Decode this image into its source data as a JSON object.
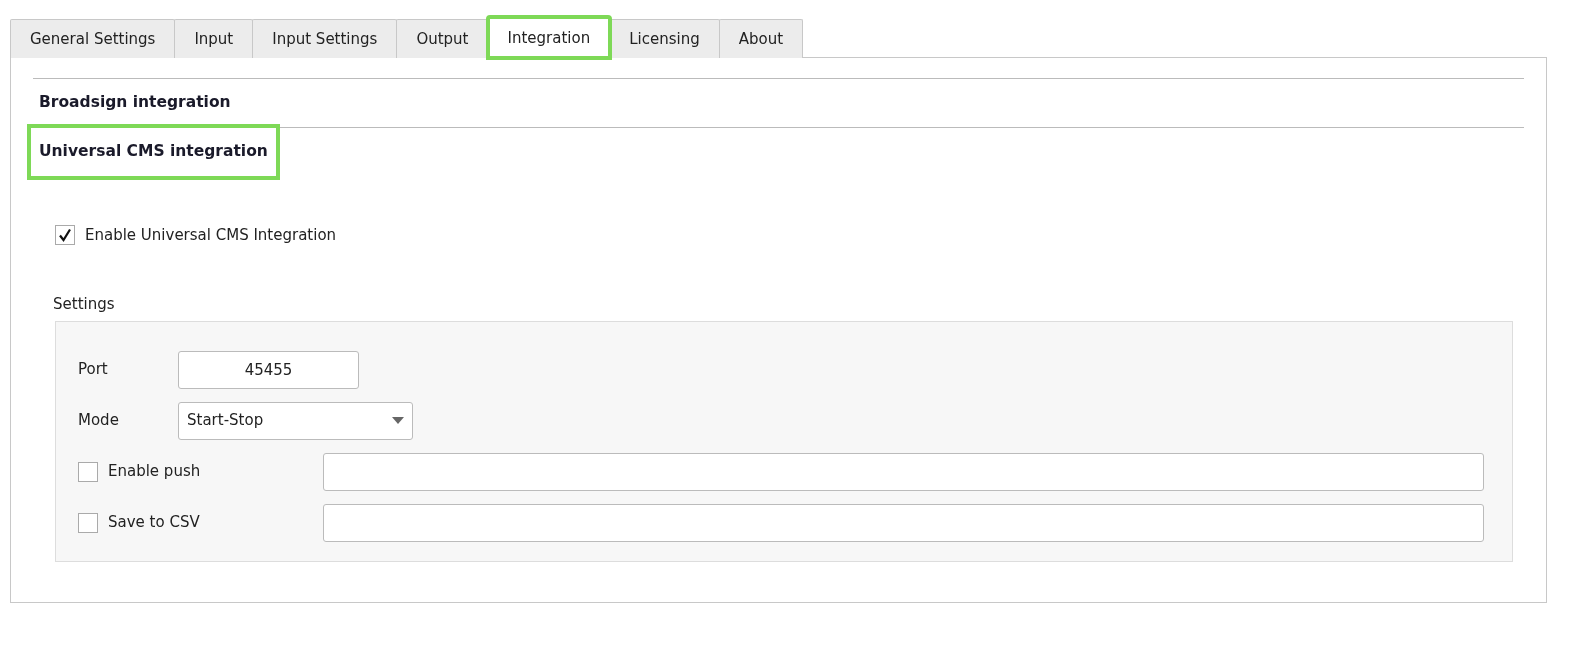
{
  "tabs": [
    {
      "label": "General Settings",
      "selected": false,
      "highlighted": false
    },
    {
      "label": "Input",
      "selected": false,
      "highlighted": false
    },
    {
      "label": "Input Settings",
      "selected": false,
      "highlighted": false
    },
    {
      "label": "Output",
      "selected": false,
      "highlighted": false
    },
    {
      "label": "Integration",
      "selected": true,
      "highlighted": true
    },
    {
      "label": "Licensing",
      "selected": false,
      "highlighted": false
    },
    {
      "label": "About",
      "selected": false,
      "highlighted": false
    }
  ],
  "sections": [
    {
      "title": "Broadsign integration",
      "highlighted": false
    },
    {
      "title": "Universal CMS integration",
      "highlighted": true
    }
  ],
  "enable": {
    "label": "Enable Universal CMS Integration",
    "checked": true
  },
  "settings": {
    "title": "Settings",
    "rows": [
      {
        "kind": "number",
        "label": "Port",
        "value": "45455"
      },
      {
        "kind": "combo",
        "label": "Mode",
        "value": "Start-Stop"
      },
      {
        "kind": "check",
        "label": "Enable push",
        "checked": false
      },
      {
        "kind": "check",
        "label": "Save to CSV",
        "checked": false
      }
    ]
  }
}
